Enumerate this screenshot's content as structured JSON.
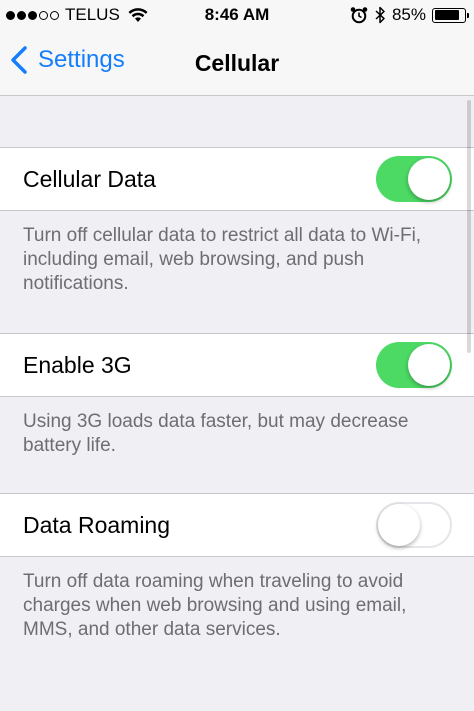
{
  "status_bar": {
    "signal_dots": [
      true,
      true,
      true,
      false,
      false
    ],
    "carrier": "TELUS",
    "time": "8:46 AM",
    "battery_percent": "85%",
    "battery_level": 0.85,
    "icons": [
      "wifi-icon",
      "alarm-icon",
      "bluetooth-icon",
      "battery-icon"
    ]
  },
  "nav": {
    "back_label": "Settings",
    "title": "Cellular"
  },
  "settings": [
    {
      "label": "Cellular Data",
      "enabled": true,
      "footer": "Turn off cellular data to restrict all data to Wi-Fi, including email, web browsing, and push notifications."
    },
    {
      "label": "Enable 3G",
      "enabled": true,
      "footer": "Using 3G loads data faster, but may decrease battery life."
    },
    {
      "label": "Data Roaming",
      "enabled": false,
      "footer": "Turn off data roaming when traveling to avoid charges when web browsing and using email, MMS, and other data services."
    }
  ],
  "colors": {
    "accent": "#157efb",
    "toggle_on": "#4cd964",
    "footer_text": "#6d6d72",
    "background": "#efeff4"
  }
}
